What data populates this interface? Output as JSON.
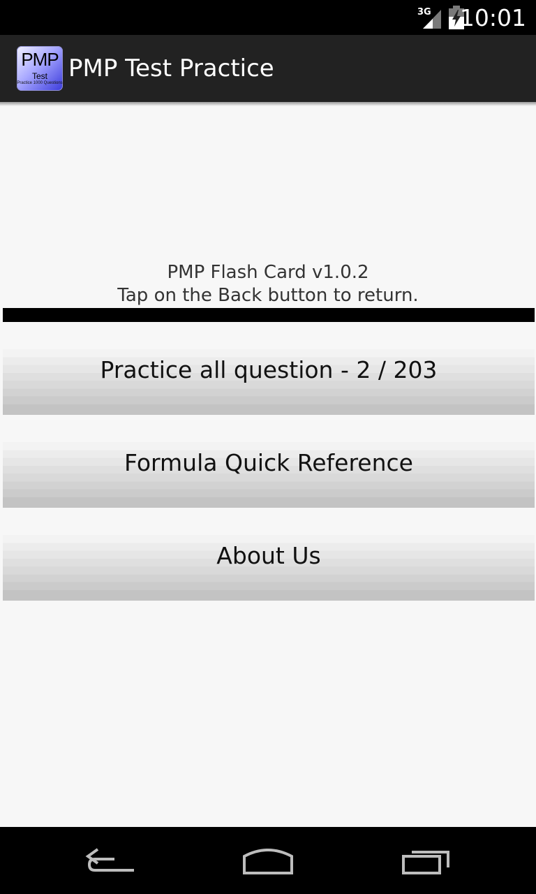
{
  "status_bar": {
    "network": "3G",
    "time": "10:01"
  },
  "action_bar": {
    "app_icon": {
      "big_text": "PMP",
      "small_text": "Test",
      "tiny_text": "Practice 1000 Questions"
    },
    "title": "PMP Test Practice"
  },
  "info": {
    "line1": "PMP Flash Card v1.0.2",
    "line2": "Tap on the Back button to return."
  },
  "menu": {
    "practice_label": "Practice all question - 2 / 203",
    "formula_label": "Formula Quick Reference",
    "about_label": "About Us"
  },
  "nav_bar": {
    "icons": [
      "back-icon",
      "home-icon",
      "recent-apps-icon"
    ]
  },
  "colors": {
    "status_bar": "#000000",
    "action_bar": "#222222",
    "background": "#f7f7f7",
    "button_top": "#f3f3f3",
    "button_bottom": "#c3c3c3"
  }
}
